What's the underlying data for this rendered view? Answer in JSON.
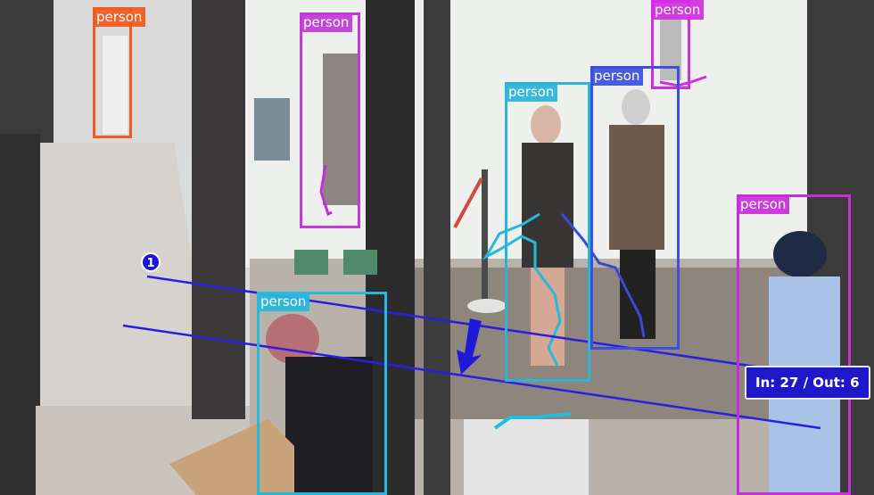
{
  "detections": [
    {
      "label": "person",
      "color": "#f15a1e"
    },
    {
      "label": "person",
      "color": "#c13ad6"
    },
    {
      "label": "person",
      "color": "#d12ee0"
    },
    {
      "label": "person",
      "color": "#2bb4d8"
    },
    {
      "label": "person",
      "color": "#3d4fdc"
    },
    {
      "label": "person",
      "color": "#c72ed9"
    },
    {
      "label": "person",
      "color": "#24b9dd"
    }
  ],
  "counting_line": {
    "id": "1",
    "color": "#2a1fe0"
  },
  "counter": {
    "text": "In: 27 / Out: 6"
  }
}
